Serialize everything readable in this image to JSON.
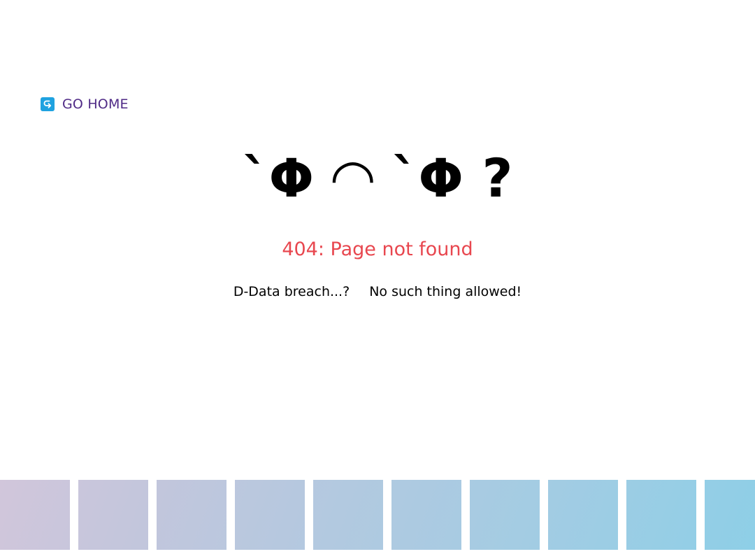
{
  "nav": {
    "go_home_label": "GO HOME",
    "icon": "return-arrow-icon"
  },
  "main": {
    "face": "`Φ ◠ `Φ ?",
    "error_title": "404: Page not found",
    "subtitle_part1": "D-Data breach...?",
    "subtitle_part2": "No such thing allowed!"
  },
  "colors": {
    "background": "#ffffff",
    "link": "#4f2a86",
    "icon_bg": "#1fa2e0",
    "error": "#e8474f",
    "tile_gradient_start": "#d2c6db",
    "tile_gradient_end": "#8dcfe7"
  }
}
